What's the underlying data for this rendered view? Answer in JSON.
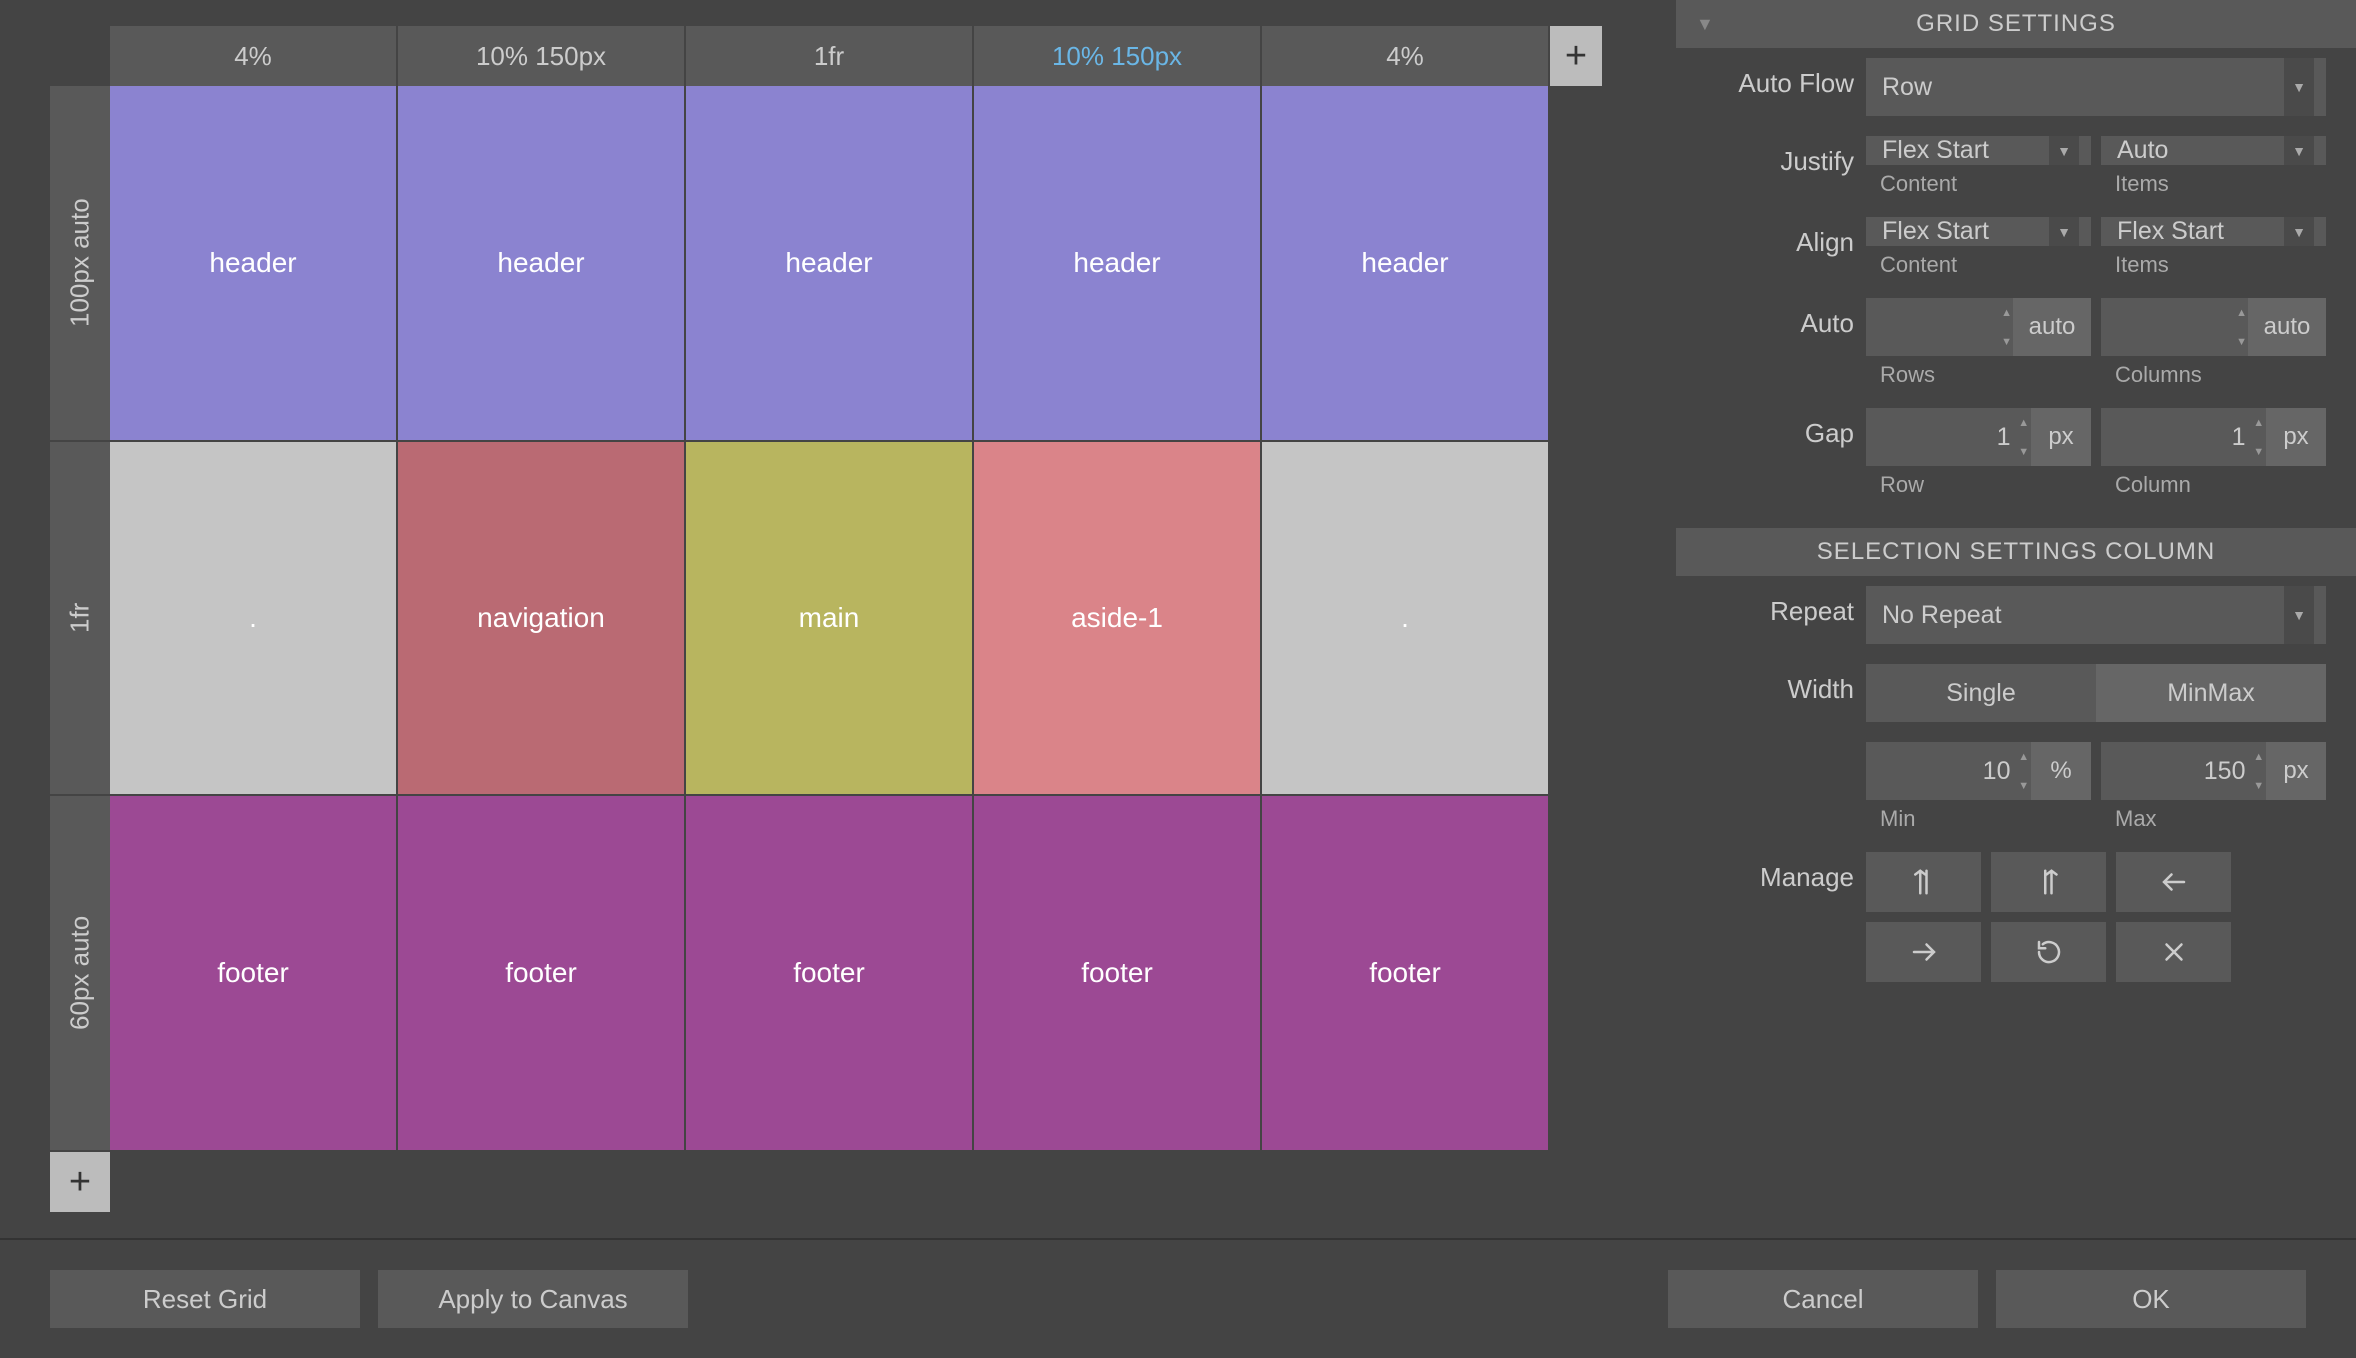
{
  "panels": {
    "grid_settings": {
      "title": "GRID SETTINGS"
    },
    "selection_settings": {
      "title": "SELECTION SETTINGS COLUMN"
    }
  },
  "grid": {
    "columns": [
      "4%",
      "10% 150px",
      "1fr",
      "10% 150px",
      "4%"
    ],
    "selected_column_index": 3,
    "rows": [
      "100px auto",
      "1fr",
      "60px auto"
    ],
    "cells": [
      [
        {
          "label": "header",
          "cls": "header-cell"
        },
        {
          "label": "header",
          "cls": "header-cell"
        },
        {
          "label": "header",
          "cls": "header-cell"
        },
        {
          "label": "header",
          "cls": "header-cell"
        },
        {
          "label": "header",
          "cls": "header-cell"
        }
      ],
      [
        {
          "label": ".",
          "cls": "empty-cell"
        },
        {
          "label": "navigation",
          "cls": "nav-cell"
        },
        {
          "label": "main",
          "cls": "main-cell"
        },
        {
          "label": "aside-1",
          "cls": "aside-cell"
        },
        {
          "label": ".",
          "cls": "empty-cell"
        }
      ],
      [
        {
          "label": "footer",
          "cls": "footer-cell"
        },
        {
          "label": "footer",
          "cls": "footer-cell"
        },
        {
          "label": "footer",
          "cls": "footer-cell"
        },
        {
          "label": "footer",
          "cls": "footer-cell"
        },
        {
          "label": "footer",
          "cls": "footer-cell"
        }
      ]
    ]
  },
  "settings": {
    "auto_flow": {
      "label": "Auto Flow",
      "value": "Row"
    },
    "justify": {
      "label": "Justify",
      "content_value": "Flex Start",
      "items_value": "Auto",
      "content_sub": "Content",
      "items_sub": "Items"
    },
    "align": {
      "label": "Align",
      "content_value": "Flex Start",
      "items_value": "Flex Start",
      "content_sub": "Content",
      "items_sub": "Items"
    },
    "auto": {
      "label": "Auto",
      "rows_value": "",
      "rows_unit": "auto",
      "cols_value": "",
      "cols_unit": "auto",
      "rows_sub": "Rows",
      "cols_sub": "Columns"
    },
    "gap": {
      "label": "Gap",
      "row_value": "1",
      "row_unit": "px",
      "col_value": "1",
      "col_unit": "px",
      "row_sub": "Row",
      "col_sub": "Column"
    },
    "repeat": {
      "label": "Repeat",
      "value": "No Repeat"
    },
    "width": {
      "label": "Width",
      "single": "Single",
      "minmax": "MinMax",
      "active": "minmax"
    },
    "minmax": {
      "min_value": "10",
      "min_unit": "%",
      "max_value": "150",
      "max_unit": "px",
      "min_sub": "Min",
      "max_sub": "Max"
    },
    "manage": {
      "label": "Manage"
    }
  },
  "footer": {
    "reset": "Reset Grid",
    "apply": "Apply to Canvas",
    "cancel": "Cancel",
    "ok": "OK"
  }
}
